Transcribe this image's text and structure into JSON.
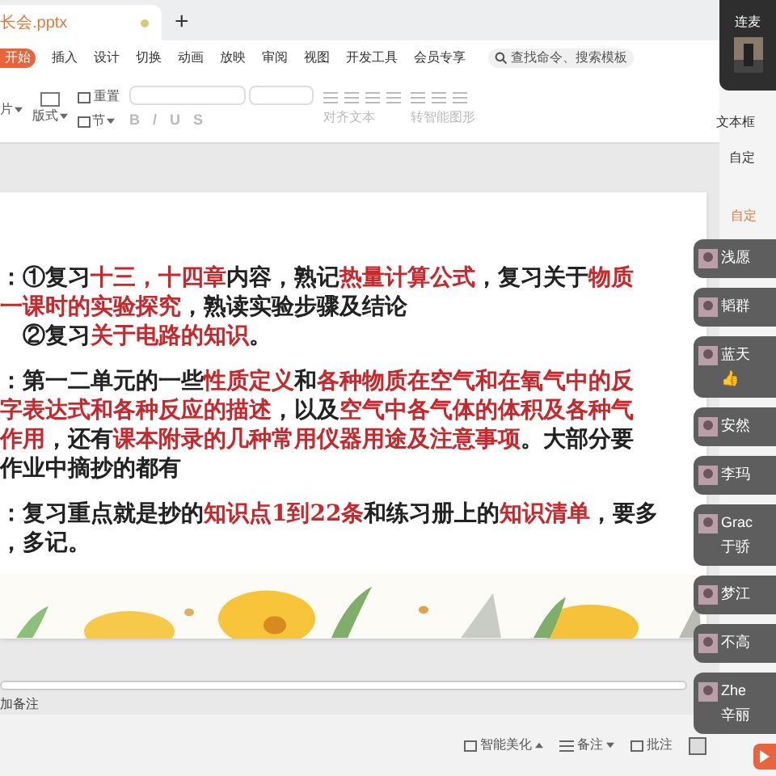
{
  "file_tab": {
    "title": "长会.pptx"
  },
  "new_tab": "+",
  "menu": [
    {
      "label": "开始",
      "selected": true
    },
    {
      "label": "插入",
      "selected": false
    },
    {
      "label": "设计",
      "selected": false
    },
    {
      "label": "切换",
      "selected": false
    },
    {
      "label": "动画",
      "selected": false
    },
    {
      "label": "放映",
      "selected": false
    },
    {
      "label": "审阅",
      "selected": false
    },
    {
      "label": "视图",
      "selected": false
    },
    {
      "label": "开发工具",
      "selected": false
    },
    {
      "label": "会员专享",
      "selected": false
    }
  ],
  "search": {
    "placeholder": "查找命令、搜索模板"
  },
  "toolbar": {
    "reset": "重置",
    "layout": "版式",
    "section": "节",
    "picture_cut": "片",
    "textbox": "文本框",
    "align_text": "对齐文本",
    "convert": "转智能图形"
  },
  "call_panel": {
    "title": "连麦"
  },
  "side_panel": {
    "header": "自定",
    "active": "自定"
  },
  "format_buttons": [
    "B",
    "/",
    "U",
    "S"
  ],
  "participants": [
    {
      "name": "浅愿"
    },
    {
      "name": "韬群"
    },
    {
      "name": "蓝天",
      "sub": "👍"
    },
    {
      "name": "安然"
    },
    {
      "name": "李玛"
    },
    {
      "name": "Grac",
      "sub": "于骄"
    },
    {
      "name": "梦江"
    },
    {
      "name": "不高"
    },
    {
      "name": "Zhe",
      "sub": "辛丽"
    }
  ],
  "slide": {
    "paragraphs": [
      [
        [
          {
            "t": "：①复习",
            "em": false
          },
          {
            "t": "十三，十四章",
            "em": true
          },
          {
            "t": "内容，熟记",
            "em": false
          },
          {
            "t": "热量计算公式",
            "em": true
          },
          {
            "t": "，复习关于",
            "em": false
          },
          {
            "t": "物质",
            "em": true
          }
        ],
        [
          {
            "t": "一课时的实验探究",
            "em": true
          },
          {
            "t": "，熟读实验步骤及结论",
            "em": false
          }
        ],
        [
          {
            "t": "　②复习",
            "em": false
          },
          {
            "t": "关于电路的知识",
            "em": true
          },
          {
            "t": "。",
            "em": false
          }
        ]
      ],
      [
        [
          {
            "t": "：第一二单元的一些",
            "em": false
          },
          {
            "t": "性质定义",
            "em": true
          },
          {
            "t": "和",
            "em": false
          },
          {
            "t": "各种物质在空气和在氧气中的反",
            "em": true
          }
        ],
        [
          {
            "t": "字表达式和各种反应的描述",
            "em": true
          },
          {
            "t": "，以及",
            "em": false
          },
          {
            "t": "空气中各气体的体积及各种气",
            "em": true
          }
        ],
        [
          {
            "t": "作用",
            "em": true
          },
          {
            "t": "，还有",
            "em": false
          },
          {
            "t": "课本附录的几种常用仪器用途及注意事项",
            "em": true
          },
          {
            "t": "。大部分要",
            "em": false
          }
        ],
        [
          {
            "t": "作业中摘抄的都有",
            "em": false
          }
        ]
      ],
      [
        [
          {
            "t": "：复习重点就是抄的",
            "em": false
          },
          {
            "t": "知识点1到22条",
            "em": true
          },
          {
            "t": "和练习册上的",
            "em": false
          },
          {
            "t": "知识清单",
            "em": true
          },
          {
            "t": "，要多",
            "em": false
          }
        ],
        [
          {
            "t": "，多记。",
            "em": false
          }
        ]
      ]
    ]
  },
  "notes": {
    "placeholder": "加备注"
  },
  "status_bar": {
    "beautify": "智能美化",
    "notes": "备注",
    "comments": "批注"
  }
}
